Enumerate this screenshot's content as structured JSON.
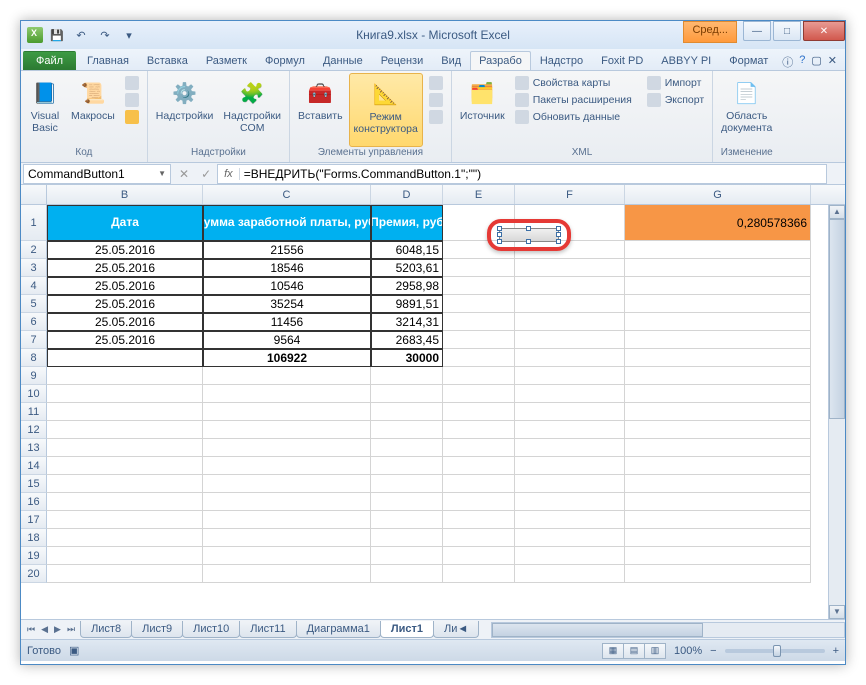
{
  "window": {
    "title": "Книга9.xlsx - Microsoft Excel",
    "badge": "Сред..."
  },
  "qat": {
    "save": "💾",
    "undo": "↶",
    "redo": "↷"
  },
  "tabs": {
    "file": "Файл",
    "items": [
      "Главная",
      "Вставка",
      "Разметк",
      "Формул",
      "Данные",
      "Рецензи",
      "Вид",
      "Разрабо",
      "Надстро",
      "Foxit PD",
      "ABBYY PI",
      "Формат"
    ],
    "active_index": 7
  },
  "ribbon": {
    "code": {
      "visual_basic": "Visual\nBasic",
      "macros": "Макросы",
      "label": "Код"
    },
    "addins": {
      "addins": "Надстройки",
      "com": "Надстройки\nCOM",
      "label": "Надстройки"
    },
    "controls": {
      "insert": "Вставить",
      "design": "Режим\nконструктора",
      "label": "Элементы управления",
      "props": "",
      "code": "",
      "dialog": ""
    },
    "xml": {
      "source": "Источник",
      "map_props": "Свойства карты",
      "expansion": "Пакеты расширения",
      "refresh": "Обновить данные",
      "import": "Импорт",
      "export": "Экспорт",
      "label": "XML"
    },
    "modify": {
      "doc_area": "Область\nдокумента",
      "label": "Изменение"
    }
  },
  "formula_bar": {
    "name_box": "CommandButton1",
    "fx": "fx",
    "formula": "=ВНЕДРИТЬ(\"Forms.CommandButton.1\";\"\")"
  },
  "columns": [
    "B",
    "C",
    "D",
    "E",
    "F",
    "G"
  ],
  "headers": {
    "B": "Дата",
    "C": "Сумма заработной платы, руб.",
    "D": "Премия, руб"
  },
  "g1_value": "0,280578366",
  "table_rows": [
    {
      "date": "25.05.2016",
      "sum": "21556",
      "bonus": "6048,15"
    },
    {
      "date": "25.05.2016",
      "sum": "18546",
      "bonus": "5203,61"
    },
    {
      "date": "25.05.2016",
      "sum": "10546",
      "bonus": "2958,98"
    },
    {
      "date": "25.05.2016",
      "sum": "35254",
      "bonus": "9891,51"
    },
    {
      "date": "25.05.2016",
      "sum": "11456",
      "bonus": "3214,31"
    },
    {
      "date": "25.05.2016",
      "sum": "9564",
      "bonus": "2683,45"
    }
  ],
  "totals": {
    "sum": "106922",
    "bonus": "30000"
  },
  "row_numbers": [
    "1",
    "2",
    "3",
    "4",
    "5",
    "6",
    "7",
    "8",
    "9",
    "10",
    "11",
    "12",
    "13",
    "14",
    "15",
    "16",
    "17",
    "18",
    "19",
    "20"
  ],
  "sheets": {
    "items": [
      "Лист8",
      "Лист9",
      "Лист10",
      "Лист11",
      "Диаграмма1",
      "Лист1"
    ],
    "active_index": 5,
    "more": "Ли◄"
  },
  "status": {
    "ready": "Готово",
    "zoom": "100%"
  }
}
